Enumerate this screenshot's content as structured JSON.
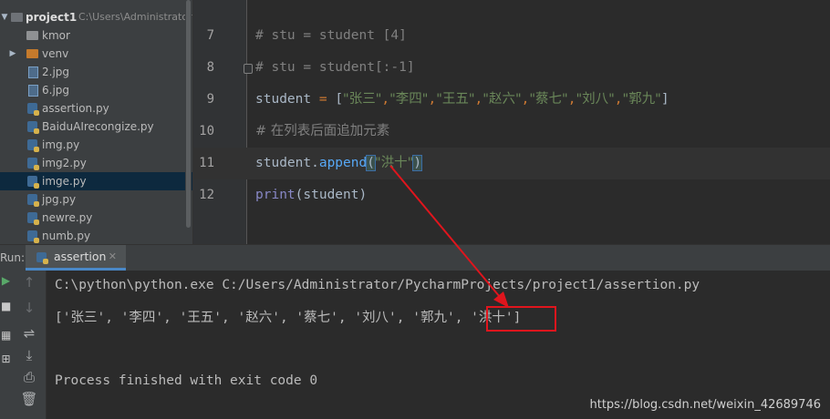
{
  "project_tree": {
    "root": {
      "name": "project1",
      "path": "C:\\Users\\Administrator"
    },
    "items": [
      {
        "label": "kmor",
        "kind": "folder"
      },
      {
        "label": "venv",
        "kind": "folder-orange"
      },
      {
        "label": "2.jpg",
        "kind": "file"
      },
      {
        "label": "6.jpg",
        "kind": "file"
      },
      {
        "label": "assertion.py",
        "kind": "py"
      },
      {
        "label": "BaiduAIrecongize.py",
        "kind": "py"
      },
      {
        "label": "img.py",
        "kind": "py"
      },
      {
        "label": "img2.py",
        "kind": "py"
      },
      {
        "label": "imge.py",
        "kind": "py"
      },
      {
        "label": "jpg.py",
        "kind": "py"
      },
      {
        "label": "newre.py",
        "kind": "py"
      },
      {
        "label": "numb.py",
        "kind": "py"
      }
    ],
    "selected_index": 8
  },
  "editor": {
    "lines": [
      {
        "num": "7",
        "comment": "# stu = student [4]"
      },
      {
        "num": "8",
        "comment": "# stu = student[:-1]"
      },
      {
        "num": "9",
        "var": "student",
        "op": " = ",
        "items": [
          "\"张三\"",
          "\"李四\"",
          "\"王五\"",
          "\"赵六\"",
          "\"蔡七\"",
          "\"刘八\"",
          "\"郭九\""
        ]
      },
      {
        "num": "10",
        "comment": "# 在列表后面追加元素"
      },
      {
        "num": "11",
        "obj": "student",
        "method": "append",
        "arg": "\"洪十\""
      },
      {
        "num": "12",
        "func": "print",
        "arg": "student"
      }
    ],
    "current_line_index": 4
  },
  "run_panel": {
    "label": "Run:",
    "tab": "assertion",
    "output": {
      "command": "C:\\python\\python.exe C:/Users/Administrator/PycharmProjects/project1/assertion.py",
      "result": "['张三', '李四', '王五', '赵六', '蔡七', '刘八', '郭九', '洪十']",
      "exit": "Process finished with exit code 0"
    }
  },
  "watermark": "https://blog.csdn.net/weixin_42689746",
  "colors": {
    "annotation_red": "#e0151d",
    "comment": "#808080",
    "string": "#6a8759",
    "method": "#57a8f5",
    "builtin": "#8888c6",
    "selection": "#0d293e"
  },
  "icons": {
    "run_toolbar": [
      "arrow-up-icon",
      "arrow-down-icon",
      "soft-wrap-icon",
      "scroll-to-end-icon",
      "print-icon",
      "trash-icon"
    ]
  }
}
